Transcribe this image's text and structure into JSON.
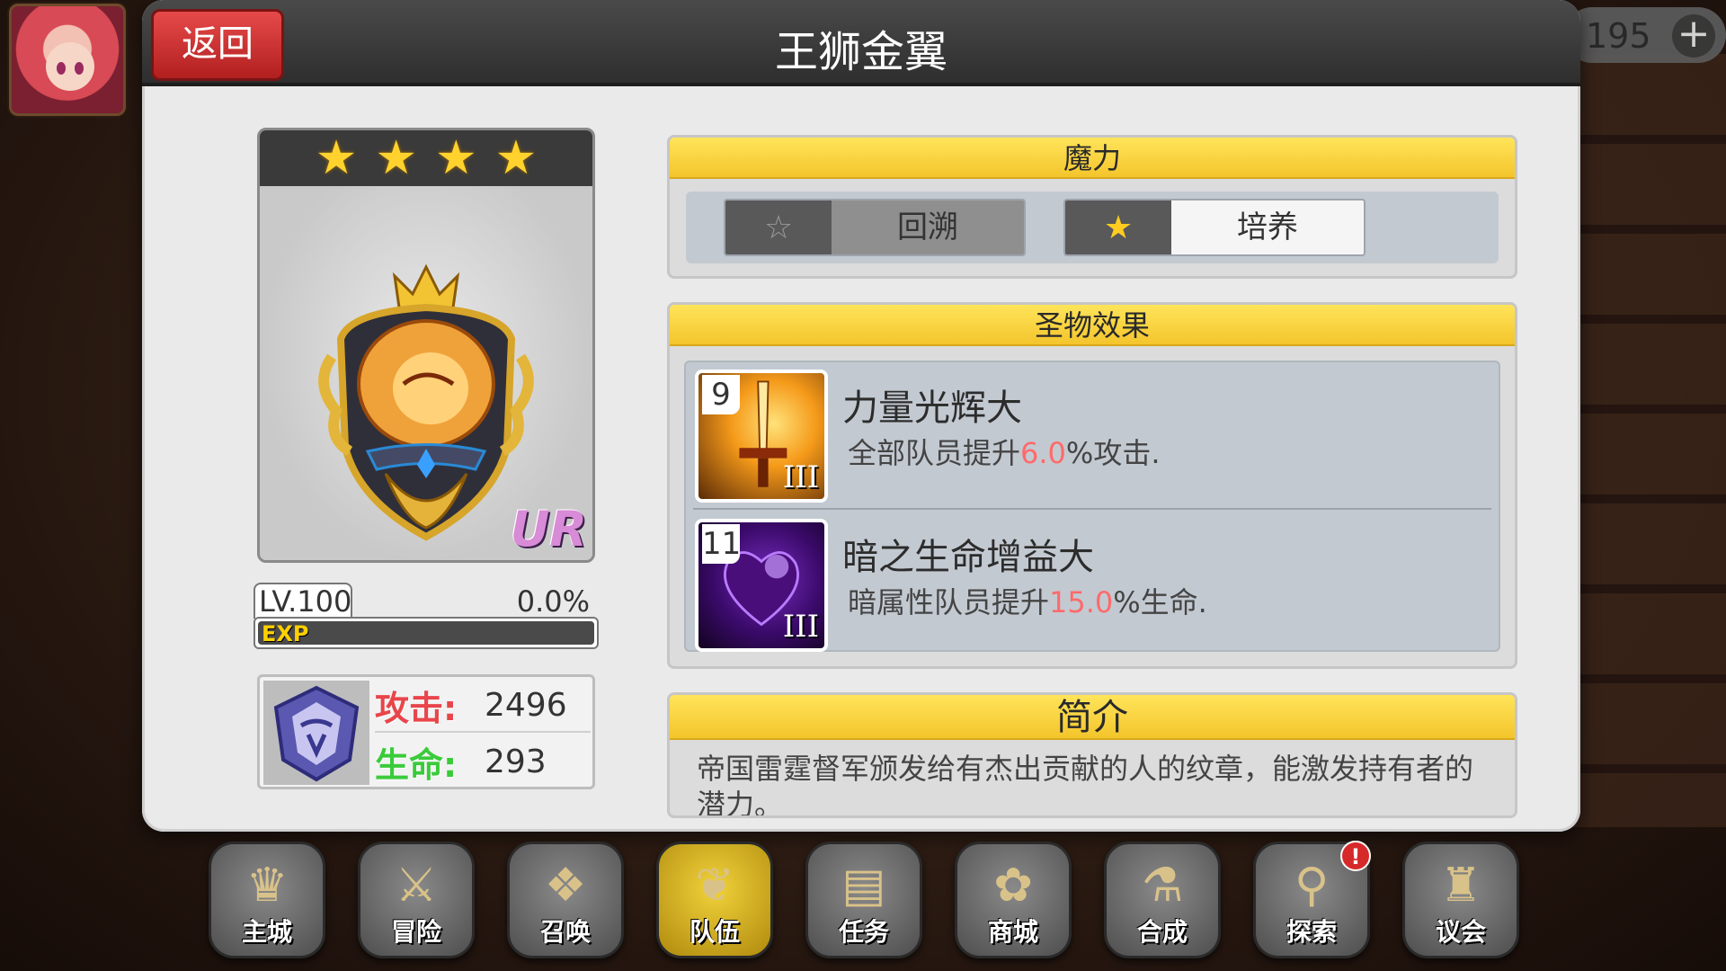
{
  "header": {
    "back_label": "返回",
    "title": "王狮金翼"
  },
  "currency": {
    "value": "195",
    "add_icon": "plus-icon"
  },
  "card": {
    "stars": 4,
    "rarity": "UR"
  },
  "level": {
    "label": "LV.100",
    "percent_text": "0.0%",
    "exp_label": "EXP",
    "exp_fraction": 0.0
  },
  "stats": {
    "attack_label": "攻击:",
    "attack_value": "2496",
    "hp_label": "生命:",
    "hp_value": "293"
  },
  "magic": {
    "title": "魔力",
    "rewind_label": "回溯",
    "train_label": "培养"
  },
  "relic": {
    "title": "圣物效果",
    "effects": [
      {
        "num": "9",
        "tier": "III",
        "name": "力量光辉大",
        "desc_pre": "全部队员提升",
        "desc_val": "6.0",
        "desc_post": "%攻击."
      },
      {
        "num": "11",
        "tier": "III",
        "name": "暗之生命增益大",
        "desc_pre": "暗属性队员提升",
        "desc_val": "15.0",
        "desc_post": "%生命."
      }
    ]
  },
  "intro": {
    "title": "简介",
    "text": "帝国雷霆督军颁发给有杰出贡献的人的纹章，能激发持有者的潜力。"
  },
  "nav": [
    {
      "label": "主城",
      "icon": "crown-icon"
    },
    {
      "label": "冒险",
      "icon": "axe-icon"
    },
    {
      "label": "召唤",
      "icon": "card-icon"
    },
    {
      "label": "队伍",
      "icon": "wings-icon",
      "active": true
    },
    {
      "label": "任务",
      "icon": "book-icon"
    },
    {
      "label": "商城",
      "icon": "shop-icon"
    },
    {
      "label": "合成",
      "icon": "potion-icon"
    },
    {
      "label": "探索",
      "icon": "compass-icon",
      "badge": "!"
    },
    {
      "label": "议会",
      "icon": "council-icon"
    }
  ]
}
